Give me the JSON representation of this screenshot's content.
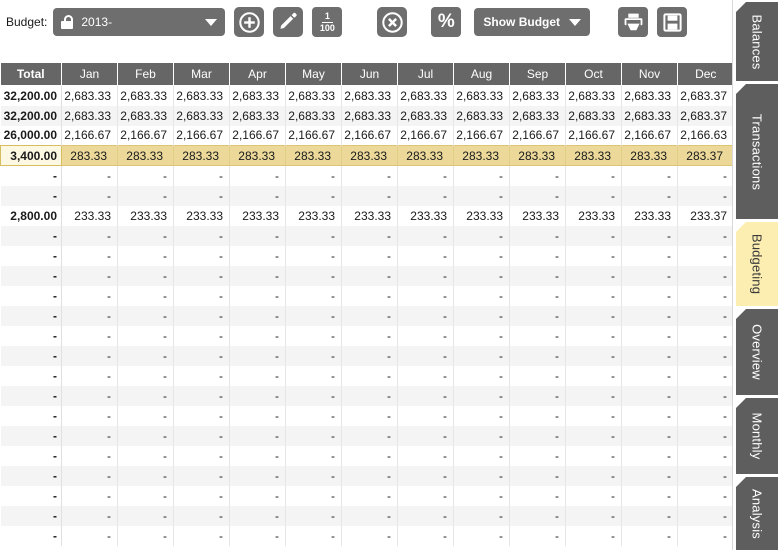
{
  "toolbar": {
    "budget_label": "Budget:",
    "budget_select_value": "2013-",
    "lock_icon": "unlocked-padlock-icon",
    "add_label": "",
    "edit_label": "",
    "fraction_numerator": "1",
    "fraction_denominator": "100",
    "delete_label": "",
    "percent_label": "%",
    "show_budget_label": "Show Budget",
    "print_label": "",
    "save_label": ""
  },
  "grid": {
    "columns": [
      "Total",
      "Jan",
      "Feb",
      "Mar",
      "Apr",
      "May",
      "Jun",
      "Jul",
      "Aug",
      "Sep",
      "Oct",
      "Nov",
      "Dec"
    ],
    "rows": [
      {
        "highlight": false,
        "cells": [
          "32,200.00",
          "2,683.33",
          "2,683.33",
          "2,683.33",
          "2,683.33",
          "2,683.33",
          "2,683.33",
          "2,683.33",
          "2,683.33",
          "2,683.33",
          "2,683.33",
          "2,683.33",
          "2,683.37"
        ]
      },
      {
        "highlight": false,
        "cells": [
          "32,200.00",
          "2,683.33",
          "2,683.33",
          "2,683.33",
          "2,683.33",
          "2,683.33",
          "2,683.33",
          "2,683.33",
          "2,683.33",
          "2,683.33",
          "2,683.33",
          "2,683.33",
          "2,683.37"
        ]
      },
      {
        "highlight": false,
        "cells": [
          "26,000.00",
          "2,166.67",
          "2,166.67",
          "2,166.67",
          "2,166.67",
          "2,166.67",
          "2,166.67",
          "2,166.67",
          "2,166.67",
          "2,166.67",
          "2,166.67",
          "2,166.67",
          "2,166.63"
        ]
      },
      {
        "highlight": true,
        "cells": [
          "3,400.00",
          "283.33",
          "283.33",
          "283.33",
          "283.33",
          "283.33",
          "283.33",
          "283.33",
          "283.33",
          "283.33",
          "283.33",
          "283.33",
          "283.37"
        ]
      },
      {
        "highlight": false,
        "cells": [
          "-",
          "-",
          "-",
          "-",
          "-",
          "-",
          "-",
          "-",
          "-",
          "-",
          "-",
          "-",
          "-"
        ]
      },
      {
        "highlight": false,
        "cells": [
          "-",
          "-",
          "-",
          "-",
          "-",
          "-",
          "-",
          "-",
          "-",
          "-",
          "-",
          "-",
          "-"
        ]
      },
      {
        "highlight": false,
        "cells": [
          "2,800.00",
          "233.33",
          "233.33",
          "233.33",
          "233.33",
          "233.33",
          "233.33",
          "233.33",
          "233.33",
          "233.33",
          "233.33",
          "233.33",
          "233.37"
        ]
      },
      {
        "highlight": false,
        "cells": [
          "-",
          "-",
          "-",
          "-",
          "-",
          "-",
          "-",
          "-",
          "-",
          "-",
          "-",
          "-",
          "-"
        ]
      },
      {
        "highlight": false,
        "cells": [
          "-",
          "-",
          "-",
          "-",
          "-",
          "-",
          "-",
          "-",
          "-",
          "-",
          "-",
          "-",
          "-"
        ]
      },
      {
        "highlight": false,
        "cells": [
          "-",
          "-",
          "-",
          "-",
          "-",
          "-",
          "-",
          "-",
          "-",
          "-",
          "-",
          "-",
          "-"
        ]
      },
      {
        "highlight": false,
        "cells": [
          "-",
          "-",
          "-",
          "-",
          "-",
          "-",
          "-",
          "-",
          "-",
          "-",
          "-",
          "-",
          "-"
        ]
      },
      {
        "highlight": false,
        "cells": [
          "-",
          "-",
          "-",
          "-",
          "-",
          "-",
          "-",
          "-",
          "-",
          "-",
          "-",
          "-",
          "-"
        ]
      },
      {
        "highlight": false,
        "cells": [
          "-",
          "-",
          "-",
          "-",
          "-",
          "-",
          "-",
          "-",
          "-",
          "-",
          "-",
          "-",
          "-"
        ]
      },
      {
        "highlight": false,
        "cells": [
          "-",
          "-",
          "-",
          "-",
          "-",
          "-",
          "-",
          "-",
          "-",
          "-",
          "-",
          "-",
          "-"
        ]
      },
      {
        "highlight": false,
        "cells": [
          "-",
          "-",
          "-",
          "-",
          "-",
          "-",
          "-",
          "-",
          "-",
          "-",
          "-",
          "-",
          "-"
        ]
      },
      {
        "highlight": false,
        "cells": [
          "-",
          "-",
          "-",
          "-",
          "-",
          "-",
          "-",
          "-",
          "-",
          "-",
          "-",
          "-",
          "-"
        ]
      },
      {
        "highlight": false,
        "cells": [
          "-",
          "-",
          "-",
          "-",
          "-",
          "-",
          "-",
          "-",
          "-",
          "-",
          "-",
          "-",
          "-"
        ]
      },
      {
        "highlight": false,
        "cells": [
          "-",
          "-",
          "-",
          "-",
          "-",
          "-",
          "-",
          "-",
          "-",
          "-",
          "-",
          "-",
          "-"
        ]
      },
      {
        "highlight": false,
        "cells": [
          "-",
          "-",
          "-",
          "-",
          "-",
          "-",
          "-",
          "-",
          "-",
          "-",
          "-",
          "-",
          "-"
        ]
      },
      {
        "highlight": false,
        "cells": [
          "-",
          "-",
          "-",
          "-",
          "-",
          "-",
          "-",
          "-",
          "-",
          "-",
          "-",
          "-",
          "-"
        ]
      },
      {
        "highlight": false,
        "cells": [
          "-",
          "-",
          "-",
          "-",
          "-",
          "-",
          "-",
          "-",
          "-",
          "-",
          "-",
          "-",
          "-"
        ]
      },
      {
        "highlight": false,
        "cells": [
          "-",
          "-",
          "-",
          "-",
          "-",
          "-",
          "-",
          "-",
          "-",
          "-",
          "-",
          "-",
          "-"
        ]
      },
      {
        "highlight": false,
        "cells": [
          "-",
          "-",
          "-",
          "-",
          "-",
          "-",
          "-",
          "-",
          "-",
          "-",
          "-",
          "-",
          "-"
        ]
      }
    ]
  },
  "tabs": [
    {
      "label": "Balances",
      "active": false
    },
    {
      "label": "Transactions",
      "active": false
    },
    {
      "label": "Budgeting",
      "active": true
    },
    {
      "label": "Overview",
      "active": false
    },
    {
      "label": "Monthly",
      "active": false
    },
    {
      "label": "Analysis",
      "active": false
    }
  ],
  "colors": {
    "toolbar_button": "#6e6e6e",
    "header": "#666666",
    "highlight_row": "#ecd99a",
    "highlight_total": "#fdf8e1",
    "active_tab": "#fbeeb0",
    "tab": "#5e5e5e"
  }
}
